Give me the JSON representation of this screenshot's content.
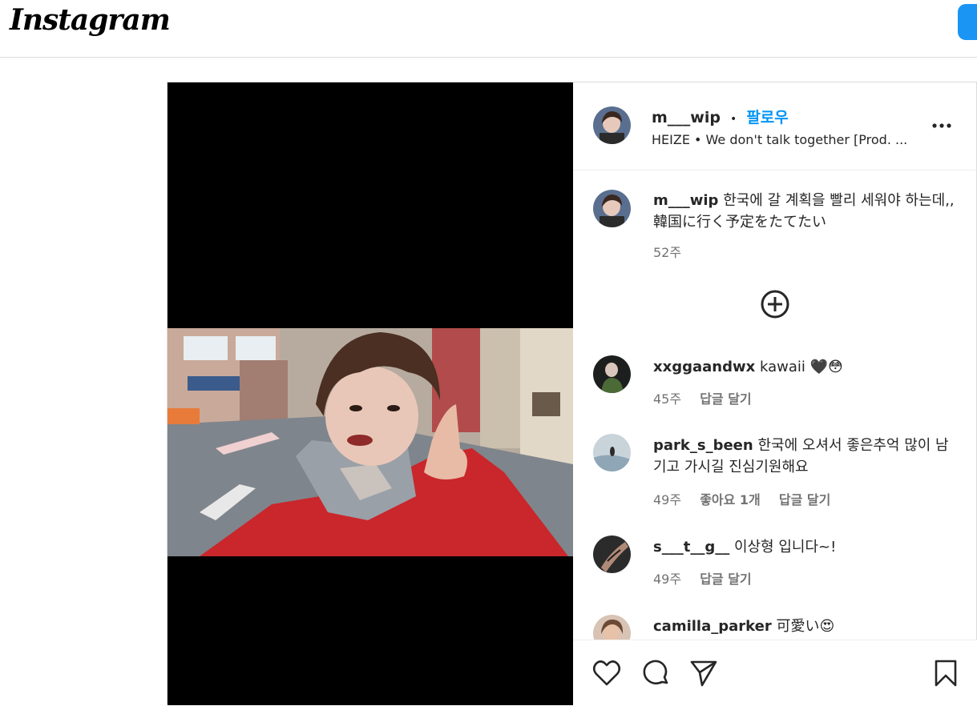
{
  "app": {
    "logo": "Instagram"
  },
  "post": {
    "author": {
      "username": "m___wip",
      "separator": "•",
      "follow_label": "팔로우",
      "audio": "HEIZE • We don't talk together [Prod. ..."
    },
    "caption": {
      "username": "m___wip",
      "text": "한국에 갈 계획을 빨리 세워야 하는데,, 韓国に行く予定をたてたい",
      "time": "52주"
    },
    "comments": [
      {
        "username": "xxggaandwx",
        "text": "kawaii 🖤😳",
        "time": "45주",
        "like_label": "",
        "reply_label": "답글 달기"
      },
      {
        "username": "park_s_been",
        "text": "한국에 오셔서 좋은추억 많이 남기고 가시길 진심기원해요",
        "time": "49주",
        "like_label": "좋아요 1개",
        "reply_label": "답글 달기"
      },
      {
        "username": "s___t__g__",
        "text": "이상형 입니다~!",
        "time": "49주",
        "like_label": "",
        "reply_label": "답글 달기"
      },
      {
        "username": "camilla_parker",
        "text": "可愛い😍",
        "time": "",
        "like_label": "",
        "reply_label": ""
      }
    ]
  },
  "icons": {
    "more": "more-options-icon",
    "load_more": "add-circle-icon",
    "like": "heart-icon",
    "comment": "comment-icon",
    "share": "send-icon",
    "save": "bookmark-icon"
  },
  "colors": {
    "accent": "#0095f6",
    "button": "#1a95f4",
    "border": "#dbdbdb",
    "muted": "#737373"
  }
}
